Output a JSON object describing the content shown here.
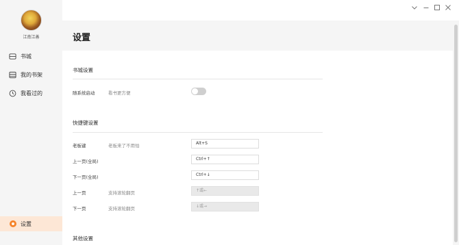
{
  "sidebar": {
    "username": "江南江善",
    "items": [
      {
        "label": "书城",
        "icon": "bookstore-icon"
      },
      {
        "label": "我的书架",
        "icon": "bookshelf-icon"
      },
      {
        "label": "我看过的",
        "icon": "history-clock-icon"
      }
    ],
    "settings": {
      "label": "设置",
      "icon": "settings-icon"
    }
  },
  "titlebar": {
    "buttons": [
      "chevron-down-icon",
      "minimize-icon",
      "maximize-icon",
      "close-icon"
    ]
  },
  "header": {
    "title": "设置"
  },
  "sections": {
    "bookstore": {
      "title": "书城设置",
      "startup_label": "随系统启动",
      "startup_desc": "看书更方便",
      "startup_enabled": false
    },
    "shortcuts": {
      "title": "快捷键设置",
      "rows": [
        {
          "label": "老板键",
          "desc": "老板来了不用怕",
          "value": "Alt+S",
          "disabled": false
        },
        {
          "label": "上一页(全局)",
          "desc": "",
          "value": "Ctrl+↑",
          "disabled": false
        },
        {
          "label": "下一页(全局)",
          "desc": "",
          "value": "Ctrl+↓",
          "disabled": false
        },
        {
          "label": "上一页",
          "desc": "支持滚轮翻页",
          "value": "↑或←",
          "disabled": true
        },
        {
          "label": "下一页",
          "desc": "支持滚轮翻页",
          "value": "↓或→",
          "disabled": true
        }
      ]
    },
    "other": {
      "title": "其他设置"
    }
  },
  "colors": {
    "accent": "#f5842b",
    "active_bg": "#fde7d6",
    "sidebar_bg": "#f5f5f5"
  }
}
